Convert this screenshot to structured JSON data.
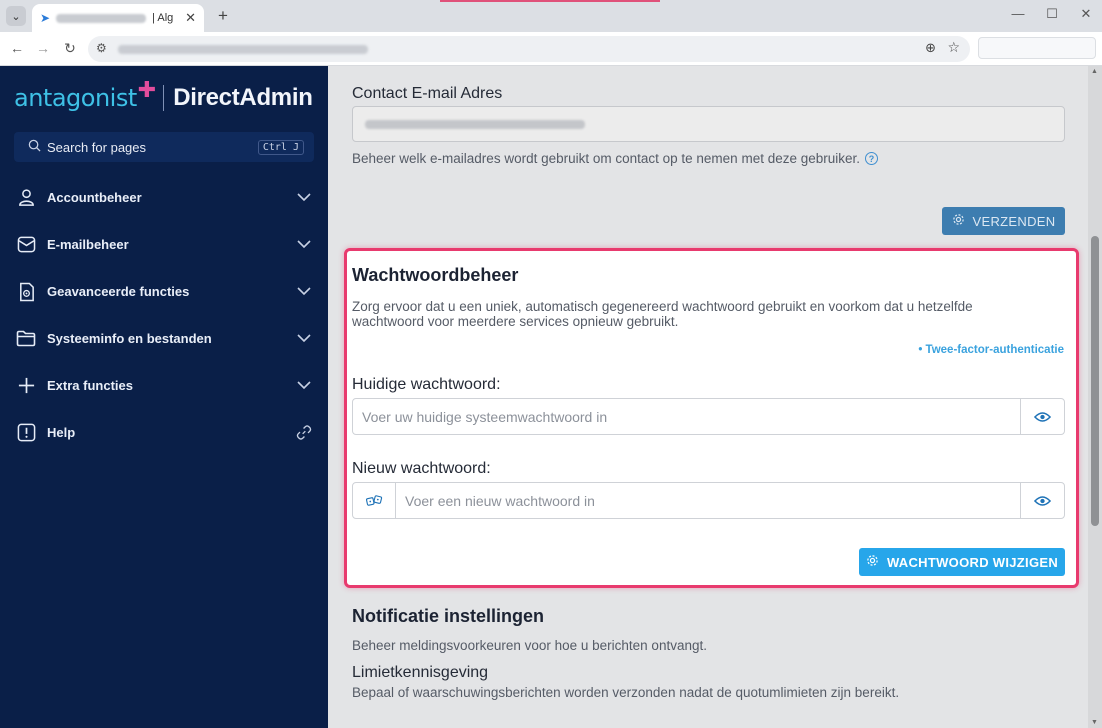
{
  "browser": {
    "tab_title": "| Alg",
    "new_tab": "+",
    "window_controls": {
      "minimize": "—",
      "maximize": "☐",
      "close": "✕"
    }
  },
  "sidebar": {
    "logo_brand": "antagonist",
    "logo_product": "DirectAdmin",
    "search_placeholder": "Search for pages",
    "search_shortcut": "Ctrl J",
    "items": [
      {
        "label": "Accountbeheer",
        "icon": "user-icon",
        "trailing": "chevron-down-icon"
      },
      {
        "label": "E-mailbeheer",
        "icon": "mail-icon",
        "trailing": "chevron-down-icon"
      },
      {
        "label": "Geavanceerde functies",
        "icon": "advanced-icon",
        "trailing": "chevron-down-icon"
      },
      {
        "label": "Systeeminfo en bestanden",
        "icon": "folder-icon",
        "trailing": "chevron-down-icon"
      },
      {
        "label": "Extra functies",
        "icon": "plus-icon",
        "trailing": "chevron-down-icon"
      },
      {
        "label": "Help",
        "icon": "alert-icon",
        "trailing": "link-icon"
      }
    ]
  },
  "contact": {
    "label": "Contact E-mail Adres",
    "help_text": "Beheer welk e-mailadres wordt gebruikt om contact op te nemen met deze gebruiker.",
    "submit_label": "VERZENDEN"
  },
  "password": {
    "title": "Wachtwoordbeheer",
    "description": "Zorg ervoor dat u een uniek, automatisch gegenereerd wachtwoord gebruikt en voorkom dat u hetzelfde wachtwoord voor meerdere services opnieuw gebruikt.",
    "tfa_link": "• Twee-factor-authenticatie",
    "current_label": "Huidige wachtwoord:",
    "current_placeholder": "Voer uw huidige systeemwachtwoord in",
    "new_label": "Nieuw wachtwoord:",
    "new_placeholder": "Voer een nieuw wachtwoord in",
    "submit_label": "WACHTWOORD WIJZIGEN"
  },
  "notifications": {
    "title": "Notificatie instellingen",
    "description": "Beheer meldingsvoorkeuren voor hoe u berichten ontvangt.",
    "limit_title": "Limietkennisgeving",
    "limit_description": "Bepaal of waarschuwingsberichten worden verzonden nadat de quotumlimieten zijn bereikt."
  },
  "colors": {
    "sidebar_bg": "#0a1f48",
    "brand": "#3ec1e6",
    "brand_accent": "#e24d9c",
    "primary_button": "#27a6ea",
    "highlight_border": "#e83a6e"
  }
}
